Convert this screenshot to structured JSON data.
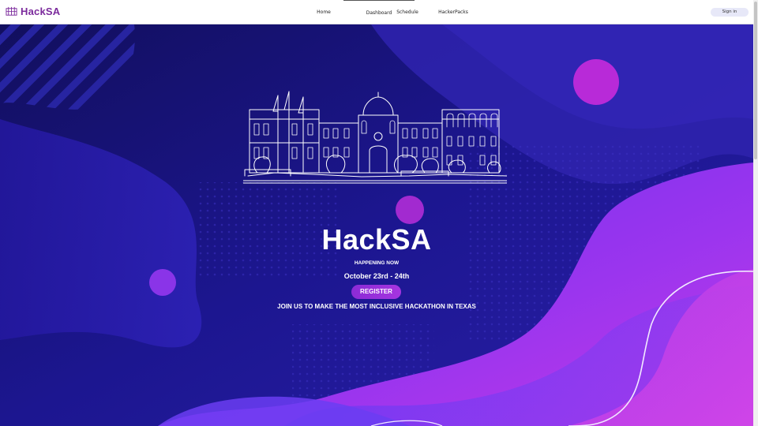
{
  "header": {
    "brand": "HackSA",
    "nav": [
      {
        "label": "Home"
      },
      {
        "label": "Dashboard"
      },
      {
        "label": "Schedule"
      },
      {
        "label": "HackerPacks"
      }
    ],
    "signin_label": "Sign in"
  },
  "hero": {
    "title": "HackSA",
    "tagline": "HAPPENING NOW",
    "dates": "October 23rd - 24th",
    "register_label": "REGISTER",
    "subtitle": "JOIN US TO MAKE THE MOST INCLUSIVE HACKATHON IN TEXAS"
  },
  "colors": {
    "brand": "#7b2a9c",
    "background_dark": "#1a1580",
    "accent_purple": "#a535e0",
    "accent_magenta": "#c233e8"
  }
}
